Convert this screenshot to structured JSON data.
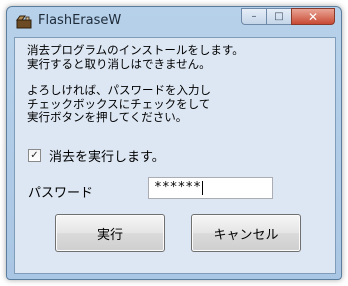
{
  "window": {
    "title": "FlashEraseW",
    "caption": {
      "minimize": "–",
      "maximize": "□",
      "close": "✕"
    }
  },
  "message": {
    "line1": "消去プログラムのインストールをします。",
    "line2": "実行すると取り消しはできません。",
    "line3": "よろしければ、パスワードを入力し",
    "line4": "チェックボックスにチェックをして",
    "line5": "実行ボタンを押してください。"
  },
  "confirm_checkbox": {
    "label": "消去を実行します。",
    "checked": true,
    "check_glyph": "✓"
  },
  "password": {
    "label": "パスワード",
    "value": "******"
  },
  "buttons": {
    "ok_label": "実行",
    "cancel_label": "キャンセル"
  }
}
